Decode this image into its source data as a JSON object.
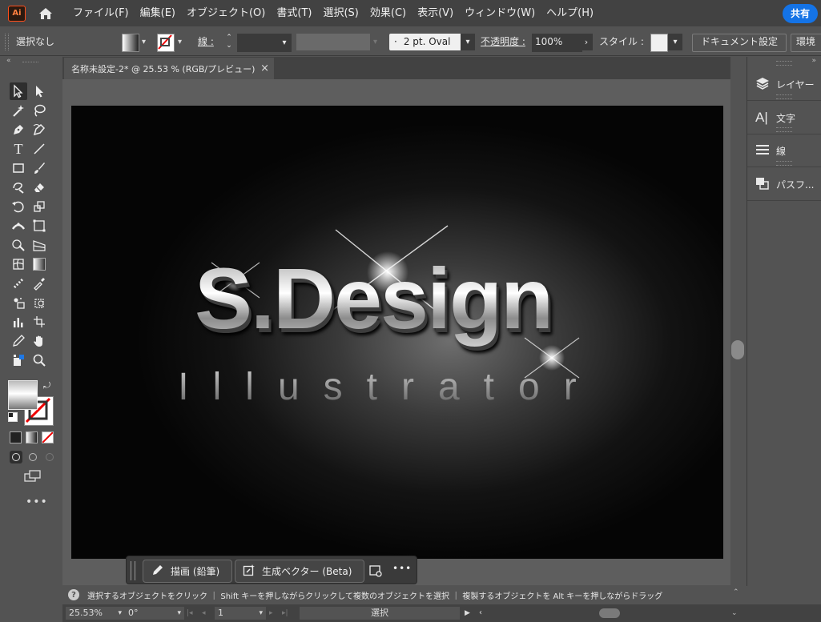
{
  "app": {
    "logo_text": "Ai",
    "share_label": "共有"
  },
  "menu": [
    "ファイル(F)",
    "編集(E)",
    "オブジェクト(O)",
    "書式(T)",
    "選択(S)",
    "効果(C)",
    "表示(V)",
    "ウィンドウ(W)",
    "ヘルプ(H)"
  ],
  "control": {
    "selection_label": "選択なし",
    "stroke_label": "線 :",
    "brush_value": "2 pt. Oval",
    "brush_dot": "·",
    "opacity_label": "不透明度 :",
    "opacity_value": "100%",
    "style_label": "スタイル :",
    "doc_setup_label": "ドキュメント設定",
    "env_label": "環境"
  },
  "tab": {
    "title": "名称未設定-2* @ 25.53 % (RGB/プレビュー)",
    "close": "×"
  },
  "artwork": {
    "title": "S.Design",
    "subtitle": "Illustrator"
  },
  "panels": [
    {
      "icon": "layers-icon",
      "label": "レイヤー"
    },
    {
      "icon": "character-icon",
      "label": "文字"
    },
    {
      "icon": "stroke-icon",
      "label": "線"
    },
    {
      "icon": "pathfinder-icon",
      "label": "パスフ..."
    }
  ],
  "floatbar": {
    "draw_label": "描画 (鉛筆)",
    "vector_label": "生成ベクター (Beta)",
    "more": "•••"
  },
  "hint": "選択するオブジェクトをクリック ｜ Shift キーを押しながらクリックして複数のオブジェクトを選択 ｜ 複製するオブジェクトを Alt キーを押しながらドラッグ",
  "status": {
    "zoom": "25.53%",
    "rotation": "0°",
    "artboard": "1",
    "mode": "選択"
  },
  "colors": {
    "accent": "#1473e6",
    "ui_dark": "#424242",
    "ui_mid": "#535353"
  }
}
